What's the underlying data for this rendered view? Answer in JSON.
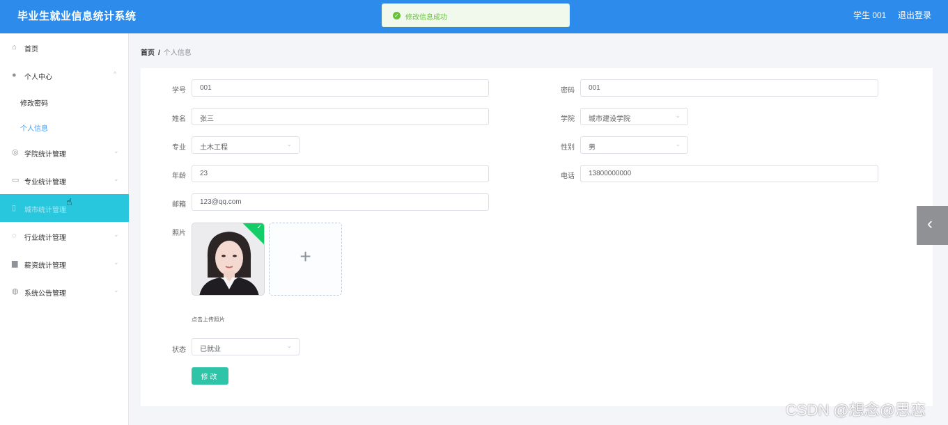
{
  "header": {
    "app_title": "毕业生就业信息统计系统",
    "user_label": "学生 001",
    "logout_label": "退出登录"
  },
  "toast": {
    "message": "修改信息成功",
    "color": "#67c23a"
  },
  "sidebar": {
    "items": [
      {
        "label": "首页",
        "icon": "home-icon",
        "glyph": "⌂"
      },
      {
        "label": "个人中心",
        "icon": "user-icon",
        "glyph": "●",
        "arrow": "^"
      },
      {
        "label": "学院统计管理",
        "icon": "building-icon",
        "glyph": "◎",
        "arrow": "⌄"
      },
      {
        "label": "专业统计管理",
        "icon": "chat-icon",
        "glyph": "▭",
        "arrow": "⌄"
      },
      {
        "label": "城市统计管理",
        "icon": "city-icon",
        "glyph": "▯",
        "arrow": "⌄"
      },
      {
        "label": "行业统计管理",
        "icon": "power-icon",
        "glyph": "◌",
        "arrow": "⌄"
      },
      {
        "label": "薪资统计管理",
        "icon": "wallet-icon",
        "glyph": "▆",
        "arrow": "⌄"
      },
      {
        "label": "系统公告管理",
        "icon": "gauge-icon",
        "glyph": "◍",
        "arrow": "⌄"
      }
    ],
    "sub_items": [
      "修改密码",
      "个人信息"
    ],
    "active_color": "#29c7de"
  },
  "breadcrumb": {
    "home": "首页",
    "separator": "/",
    "current": "个人信息"
  },
  "form": {
    "student_id": {
      "label": "学号",
      "value": "001"
    },
    "password": {
      "label": "密码",
      "value": "001"
    },
    "name": {
      "label": "姓名",
      "value": "张三"
    },
    "college": {
      "label": "学院",
      "value": "城市建设学院"
    },
    "major": {
      "label": "专业",
      "value": "土木工程"
    },
    "gender": {
      "label": "性别",
      "value": "男"
    },
    "age": {
      "label": "年龄",
      "value": "23"
    },
    "phone": {
      "label": "电话",
      "value": "13800000000"
    },
    "email": {
      "label": "邮箱",
      "value": "123@qq.com"
    },
    "photo": {
      "label": "照片",
      "hint": "点击上传照片"
    },
    "status": {
      "label": "状态",
      "value": "已就业"
    },
    "submit_label": "修改"
  },
  "dropdown_glyph": "⌄",
  "plus_glyph": "+",
  "collapse_glyph": "‹",
  "check_glyph": "✓",
  "watermark": "CSDN @想念@思恋",
  "theme": {
    "primary": "#2d8ceb",
    "button": "#2fc4a8"
  }
}
